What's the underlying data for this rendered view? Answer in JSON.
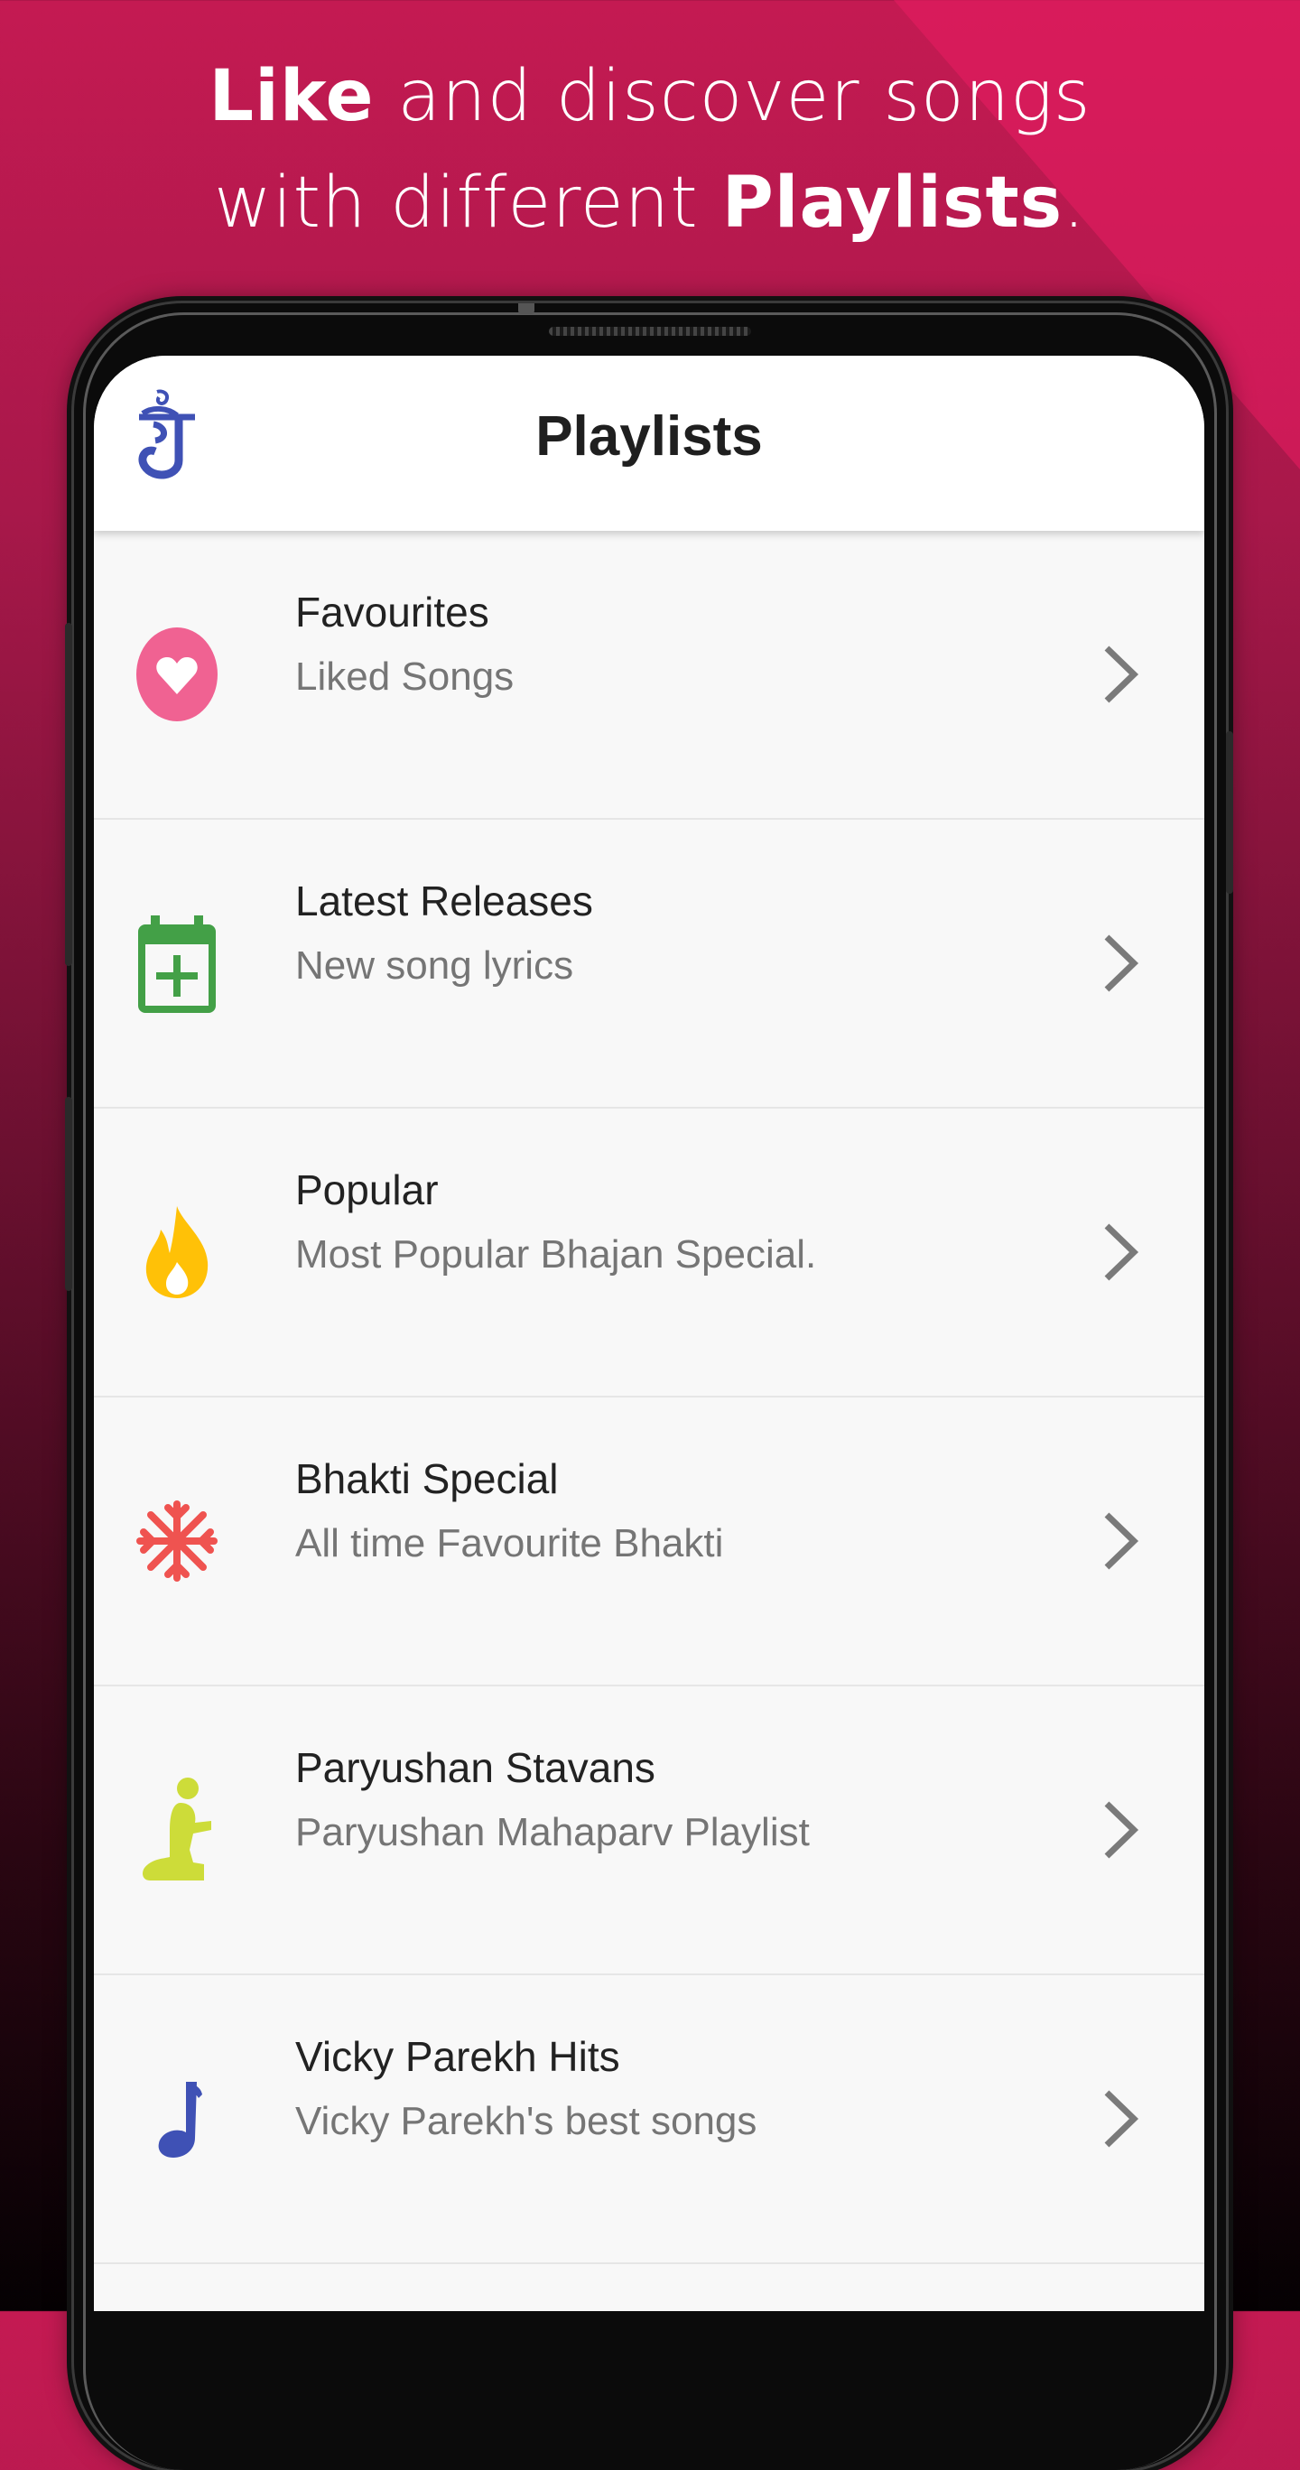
{
  "promo": {
    "headline_bold_1": "Like",
    "headline_text_1": " and discover songs",
    "headline_text_2": "with different ",
    "headline_bold_2": "Playlists",
    "headline_end": "."
  },
  "app_bar": {
    "title": "Playlists",
    "logo_icon": "jain-logo-icon"
  },
  "playlists": [
    {
      "title": "Favourites",
      "subtitle": "Liked Songs",
      "icon": "heart-icon",
      "color": "#f06292"
    },
    {
      "title": "Latest Releases",
      "subtitle": "New song lyrics",
      "icon": "calendar-add-icon",
      "color": "#43a047"
    },
    {
      "title": "Popular",
      "subtitle": "Most Popular Bhajan Special.",
      "icon": "fire-icon",
      "color": "#ffc107"
    },
    {
      "title": "Bhakti Special",
      "subtitle": "All time Favourite Bhakti",
      "icon": "snowflake-icon",
      "color": "#ef5350"
    },
    {
      "title": "Paryushan Stavans",
      "subtitle": "Paryushan Mahaparv Playlist",
      "icon": "praying-person-icon",
      "color": "#cddc39"
    },
    {
      "title": "Vicky Parekh Hits",
      "subtitle": "Vicky Parekh's best songs",
      "icon": "music-note-icon",
      "color": "#3f51b5"
    }
  ],
  "colors": {
    "background_top": "#c41a52",
    "background_bottom": "#050103",
    "chevron": "#7a7a7a"
  }
}
